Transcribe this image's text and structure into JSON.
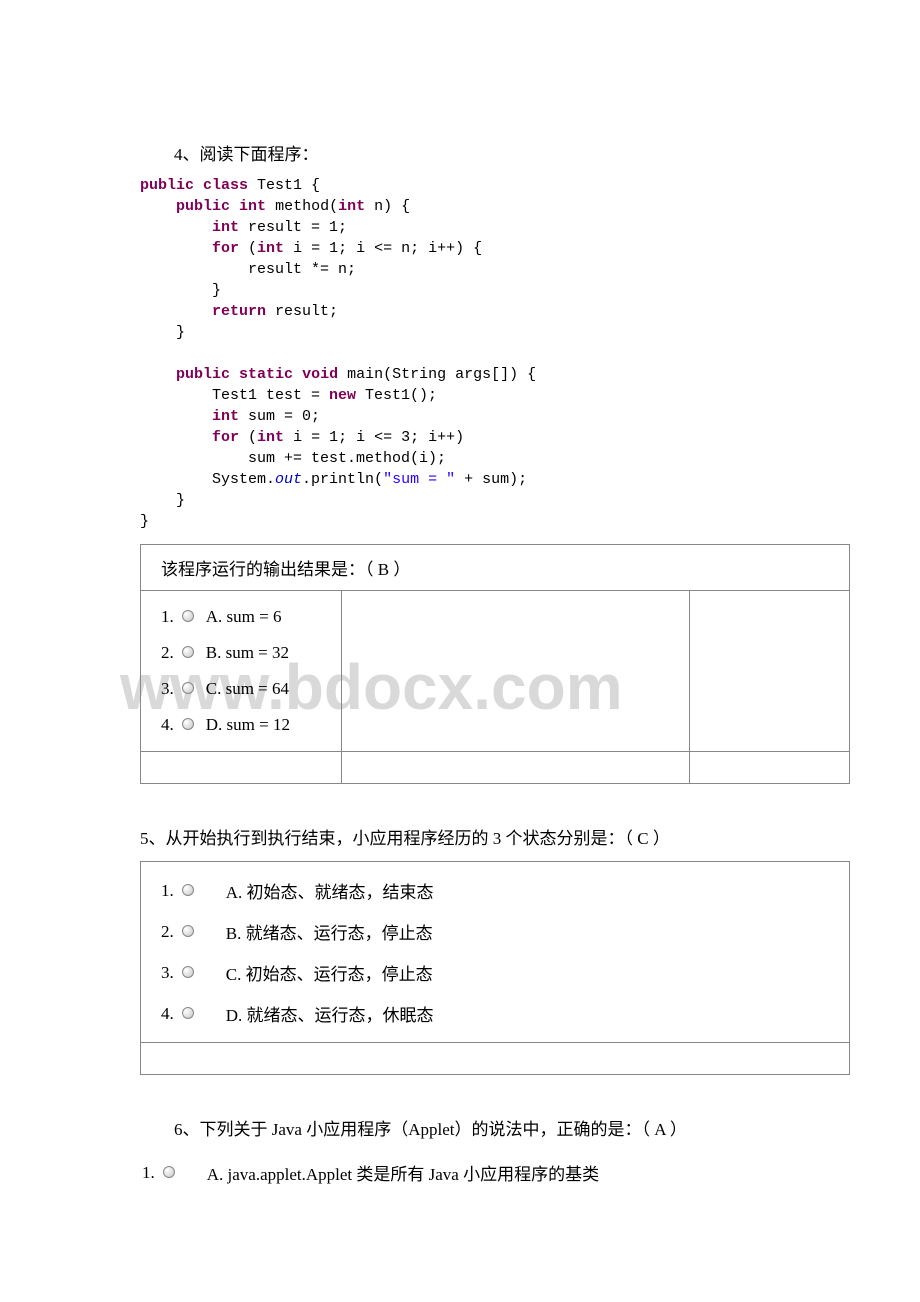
{
  "watermark": "www.bdocx.com",
  "q4": {
    "title": "4、阅读下面程序：",
    "result_line": "该程序运行的输出结果是：（ B ）",
    "options": [
      {
        "num": "1.",
        "label": "A. sum = 6"
      },
      {
        "num": "2.",
        "label": "B. sum = 32"
      },
      {
        "num": "3.",
        "label": "C. sum = 64"
      },
      {
        "num": "4.",
        "label": "D. sum = 12"
      }
    ]
  },
  "q5": {
    "title": "5、从开始执行到执行结束，小应用程序经历的 3 个状态分别是：（ C ）",
    "options": [
      {
        "num": "1.",
        "label": "A. 初始态、就绪态，结束态"
      },
      {
        "num": "2.",
        "label": "B. 就绪态、运行态，停止态"
      },
      {
        "num": "3.",
        "label": "C. 初始态、运行态，停止态"
      },
      {
        "num": "4.",
        "label": "D. 就绪态、运行态，休眠态"
      }
    ]
  },
  "q6": {
    "title": "6、下列关于 Java 小应用程序（Applet）的说法中，正确的是：（ A  ）",
    "option": {
      "num": "1.",
      "label": "A. java.applet.Applet 类是所有 Java 小应用程序的基类"
    }
  },
  "code": {
    "kw_public": "public",
    "kw_class": "class",
    "kw_int": "int",
    "kw_for": "for",
    "kw_return": "return",
    "kw_static": "static",
    "kw_void": "void",
    "kw_new": "new",
    "cls_name": " Test1 {",
    "m1_sig": " method(",
    "m1_param": " n) {",
    "l_result": " result = 1;",
    "for1_a": " (",
    "for1_b": " i = 1; i <= n; i++) {",
    "l_mul": "            result *= n;",
    "l_cb1": "        }",
    "l_ret": " result;",
    "l_cb2": "    }",
    "m2_sig": " main(String args[]) {",
    "l_test": "        Test1 test = ",
    "l_test2": " Test1();",
    "l_sum": " sum = 0;",
    "for2_b": " i = 1; i <= 3; i++)",
    "l_sumadd": "            sum += test.method(i);",
    "l_sys1": "        System.",
    "l_out": "out",
    "l_sys2": ".println(",
    "l_str": "\"sum = \"",
    "l_sys3": " + sum);",
    "l_cb3": "    }",
    "l_cb4": "}"
  }
}
